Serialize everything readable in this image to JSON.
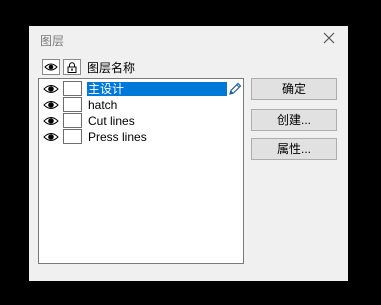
{
  "window": {
    "title": "图层"
  },
  "header": {
    "visibility_icon": "eye-icon",
    "lock_icon": "lock-icon",
    "name_label": "图层名称"
  },
  "layers": [
    {
      "name": "主设计",
      "visible": true,
      "locked": false,
      "selected": true
    },
    {
      "name": "hatch",
      "visible": true,
      "locked": false,
      "selected": false
    },
    {
      "name": "Cut lines",
      "visible": true,
      "locked": false,
      "selected": false
    },
    {
      "name": "Press lines",
      "visible": true,
      "locked": false,
      "selected": false
    }
  ],
  "buttons": {
    "ok": "确定",
    "create": "创建...",
    "properties": "属性..."
  },
  "colors": {
    "selection": "#0078d7",
    "dialog_bg": "#f0f0f0",
    "button_bg": "#e1e1e1",
    "pencil": "#1e5fa8"
  }
}
